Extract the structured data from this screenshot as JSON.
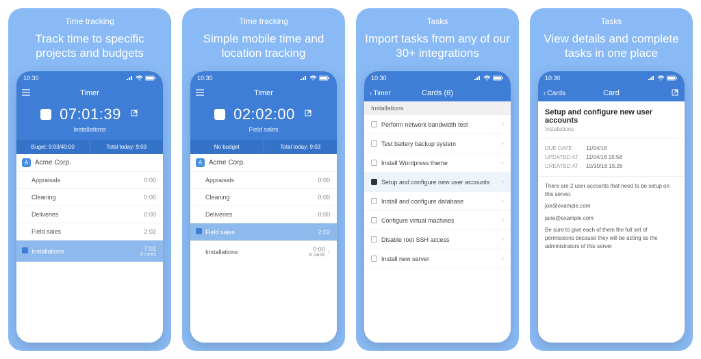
{
  "screens": [
    {
      "category": "Time tracking",
      "headline": "Track time to specific projects and budgets",
      "statusTime": "10:30",
      "navTitle": "Timer",
      "timer": "07:01:39",
      "subtitle": "Installations",
      "infoLeft": "Buget: 9:03/40:00",
      "infoRight": "Total today: 9:03",
      "client": "Acme Corp.",
      "clientInitial": "A",
      "projects": [
        {
          "name": "Appraisals",
          "time": "0:00"
        },
        {
          "name": "Cleaning",
          "time": "0:00"
        },
        {
          "name": "Deliveries",
          "time": "0:00"
        },
        {
          "name": "Field sales",
          "time": "2:02"
        }
      ],
      "selected": {
        "name": "Installations",
        "time": "7:01",
        "sub": "8 cards"
      }
    },
    {
      "category": "Time tracking",
      "headline": "Simple mobile time and location tracking",
      "statusTime": "10:30",
      "navTitle": "Timer",
      "timer": "02:02:00",
      "subtitle": "Field sales",
      "infoLeft": "No budget",
      "infoRight": "Total today: 9:03",
      "client": "Acme Corp.",
      "clientInitial": "A",
      "projects": [
        {
          "name": "Appraisals",
          "time": "0:00"
        },
        {
          "name": "Cleaning",
          "time": "0:00"
        },
        {
          "name": "Deliveries",
          "time": "0:00"
        }
      ],
      "selectedMid": {
        "name": "Field sales",
        "time": "2:02"
      },
      "after": {
        "name": "Installations",
        "time": "0:00",
        "sub": "8 cards"
      }
    },
    {
      "category": "Tasks",
      "headline": "Import tasks from any of our 30+ integrations",
      "statusTime": "10:30",
      "backLabel": "Timer",
      "navTitle": "Cards (8)",
      "section": "Installations",
      "tasks": [
        {
          "name": "Perform network bandwidth test",
          "checked": false
        },
        {
          "name": "Test battery backup system",
          "checked": false
        },
        {
          "name": "Install Wordpress theme",
          "checked": false
        },
        {
          "name": "Setup and configure new user accounts",
          "checked": true,
          "selected": true
        },
        {
          "name": "Install and configure database",
          "checked": false
        },
        {
          "name": "Configure virtual machines",
          "checked": false
        },
        {
          "name": "Disable root SSH access",
          "checked": false
        },
        {
          "name": "Install new server",
          "checked": false
        }
      ]
    },
    {
      "category": "Tasks",
      "headline": "View details and complete tasks in one place",
      "statusTime": "10:30",
      "backLabel": "Cards",
      "navTitle": "Card",
      "detailTitle": "Setup and configure new user accounts",
      "detailSub": "Installations",
      "meta": [
        {
          "k": "DUE DATE",
          "v": "11/04/16"
        },
        {
          "k": "UPDATED AT",
          "v": "11/04/16 15:58"
        },
        {
          "k": "CREATED AT",
          "v": "10/30/16 15:26"
        }
      ],
      "body": [
        "There are 2 user accounts that need to be setup on this server.",
        "joe@example.com",
        "jane@example.com",
        "Be sure to give each of them the full set of permissions because they will be acting as the administrators of this server"
      ]
    }
  ]
}
